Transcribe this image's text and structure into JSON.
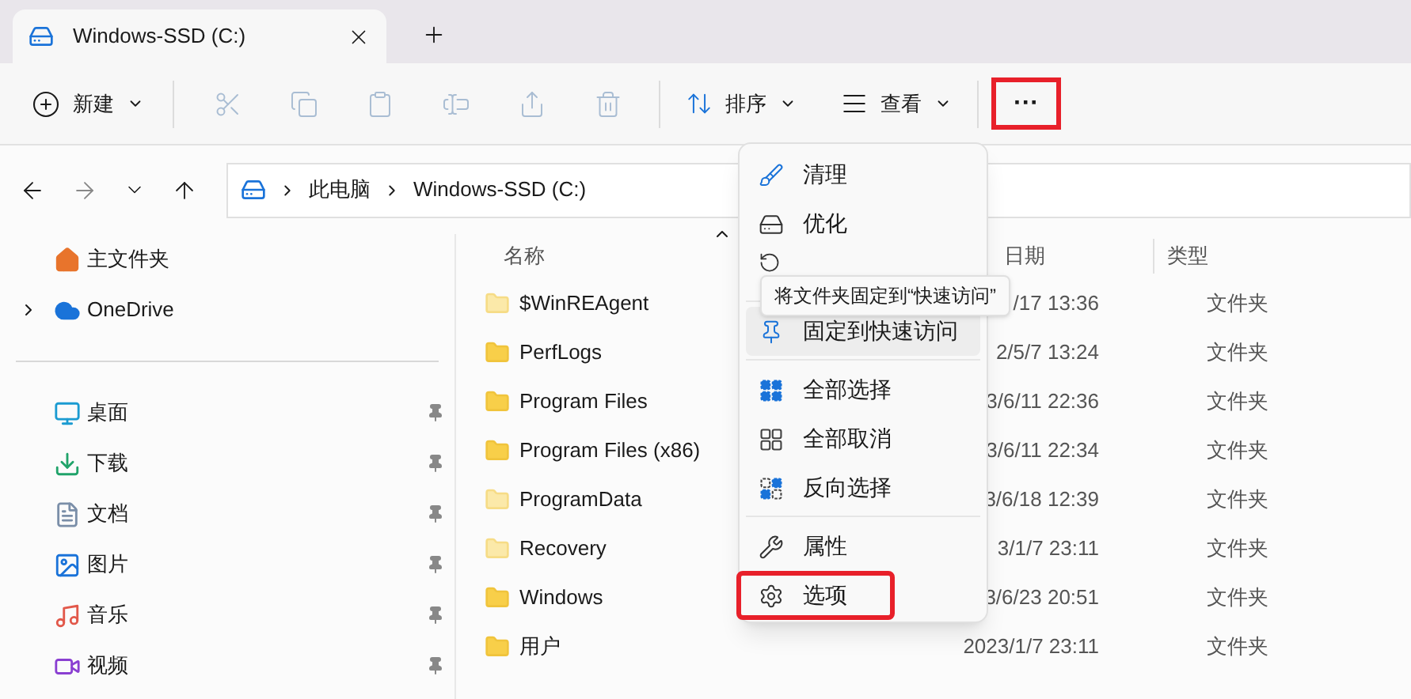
{
  "tabs": [
    {
      "label": "Windows-SSD (C:)",
      "selected": true
    }
  ],
  "toolbar": {
    "new_button": {
      "label": "新建"
    },
    "actions": [
      {
        "kind": "cut",
        "disabled": true
      },
      {
        "kind": "copy",
        "disabled": true
      },
      {
        "kind": "paste",
        "disabled": true
      },
      {
        "kind": "rename",
        "disabled": true
      },
      {
        "kind": "share",
        "disabled": true
      },
      {
        "kind": "delete",
        "disabled": true
      }
    ],
    "sort_button": {
      "label": "排序"
    },
    "view_button": {
      "label": "查看"
    },
    "more_button": {
      "label": "···",
      "annotated": true
    }
  },
  "address_bar": {
    "breadcrumbs": [
      "此电脑",
      "Windows-SSD (C:)"
    ]
  },
  "nav_pane": {
    "top_items": [
      {
        "kind": "home",
        "label": "主文件夹",
        "expandable": false
      },
      {
        "kind": "cloud",
        "label": "OneDrive",
        "expandable": true
      }
    ],
    "pinned_items": [
      {
        "kind": "desktop",
        "label": "桌面",
        "pinned": true
      },
      {
        "kind": "download",
        "label": "下载",
        "pinned": true
      },
      {
        "kind": "documents",
        "label": "文档",
        "pinned": true
      },
      {
        "kind": "pictures",
        "label": "图片",
        "pinned": true
      },
      {
        "kind": "music",
        "label": "音乐",
        "pinned": true
      },
      {
        "kind": "videos",
        "label": "视频",
        "pinned": true
      }
    ]
  },
  "file_list": {
    "columns": [
      "名称",
      "日期",
      "类型"
    ],
    "rows": [
      {
        "name": "$WinREAgent",
        "date": "/17 13:36",
        "type": "文件夹",
        "faded": true
      },
      {
        "name": "PerfLogs",
        "date": "2/5/7 13:24",
        "type": "文件夹",
        "faded": false
      },
      {
        "name": "Program Files",
        "date": "3/6/11 22:36",
        "type": "文件夹",
        "faded": false
      },
      {
        "name": "Program Files (x86)",
        "date": "3/6/11 22:34",
        "type": "文件夹",
        "faded": false
      },
      {
        "name": "ProgramData",
        "date": "3/6/18 12:39",
        "type": "文件夹",
        "faded": true
      },
      {
        "name": "Recovery",
        "date": "3/1/7 23:11",
        "type": "文件夹",
        "faded": true
      },
      {
        "name": "Windows",
        "date": "3/6/23 20:51",
        "type": "文件夹",
        "faded": false
      },
      {
        "name": "用户",
        "date": "2023/1/7 23:11",
        "type": "文件夹",
        "faded": false
      }
    ]
  },
  "more_menu": {
    "groups": [
      [
        {
          "kind": "cleanup",
          "label": "清理",
          "selected": false,
          "annotated": false
        },
        {
          "kind": "optimize",
          "label": "优化",
          "selected": false,
          "annotated": false
        },
        {
          "kind": "format",
          "selected": false,
          "annotated": false
        }
      ],
      [
        {
          "kind": "pin",
          "label": "固定到快速访问",
          "selected": true,
          "annotated": false
        }
      ],
      [
        {
          "kind": "select_all",
          "label": "全部选择",
          "selected": false,
          "annotated": false
        },
        {
          "kind": "select_none",
          "label": "全部取消",
          "selected": false,
          "annotated": false
        },
        {
          "kind": "invert",
          "label": "反向选择",
          "selected": false,
          "annotated": false
        }
      ],
      [
        {
          "kind": "properties",
          "label": "属性",
          "selected": false,
          "annotated": false
        },
        {
          "kind": "options",
          "label": "选项",
          "selected": false,
          "annotated": true
        }
      ]
    ]
  },
  "tooltip": {
    "text": "将文件夹固定到“快速访问”"
  }
}
